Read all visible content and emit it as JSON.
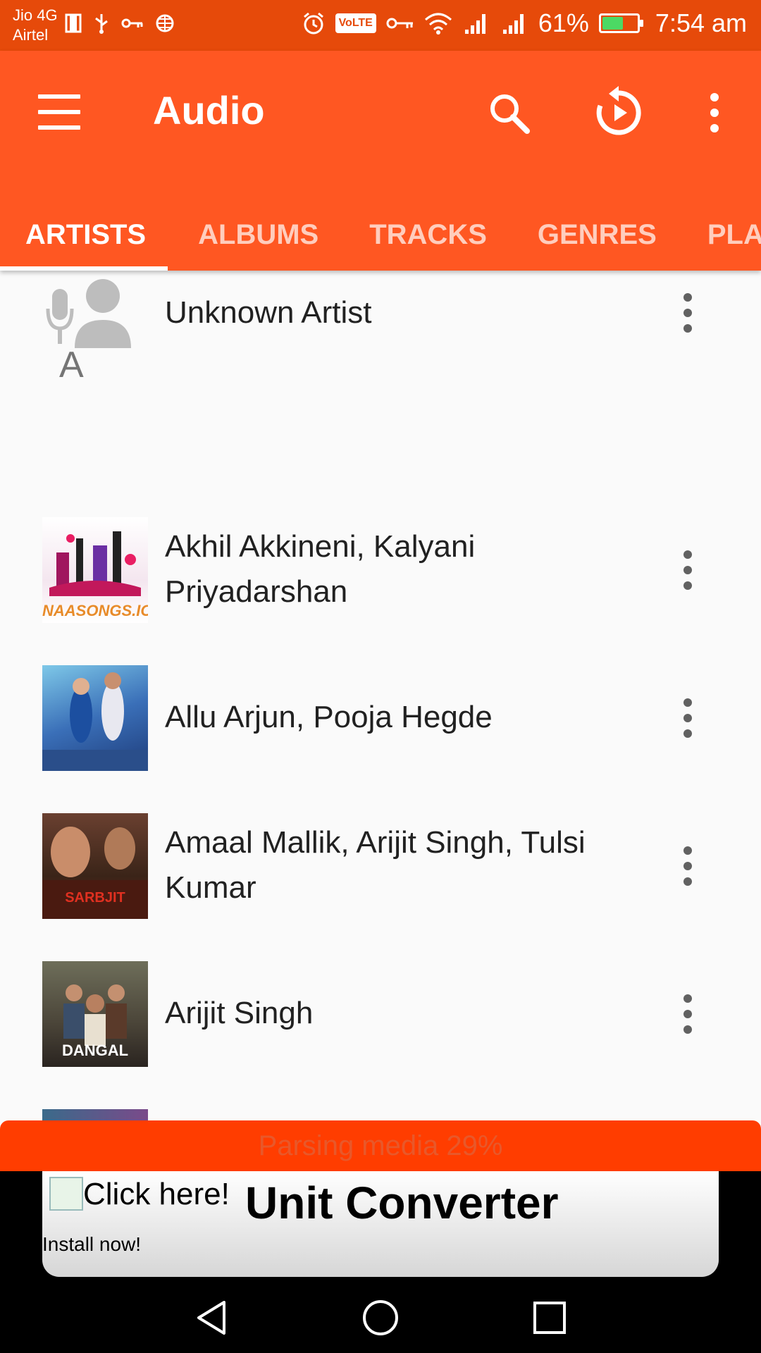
{
  "status_bar": {
    "carrier_1": "Jio 4G",
    "carrier_2": "Airtel",
    "volte": "VoLTE",
    "battery_percent": "61%",
    "battery_level": 0.61,
    "time": "7:54 am"
  },
  "app_bar": {
    "title": "Audio",
    "icons": [
      "menu-icon",
      "search-icon",
      "replay-icon",
      "more-vert-icon"
    ]
  },
  "tabs": [
    {
      "label": "ARTISTS",
      "active": true
    },
    {
      "label": "ALBUMS",
      "active": false
    },
    {
      "label": "TRACKS",
      "active": false
    },
    {
      "label": "GENRES",
      "active": false
    },
    {
      "label": "PLAYLISTS",
      "active": false
    }
  ],
  "list": {
    "unknown_artist": "Unknown Artist",
    "section_letter": "A",
    "artists": [
      {
        "name_line1": "Akhil Akkineni, Kalyani",
        "name_line2": "Priyadarshan",
        "thumb_text": "NAASONGS.IO"
      },
      {
        "name_line1": "Allu Arjun, Pooja Hegde",
        "name_line2": "",
        "thumb_text": ""
      },
      {
        "name_line1": "Amaal Mallik, Arijit Singh, Tulsi",
        "name_line2": "Kumar",
        "thumb_text": "SARBJIT"
      },
      {
        "name_line1": "Arijit Singh",
        "name_line2": "",
        "thumb_text": "DANGAL"
      }
    ]
  },
  "progress": {
    "label": "Parsing media 29%",
    "percent": 29
  },
  "ad": {
    "click_text": "Click here!",
    "title": "Unit Converter",
    "install_text": "Install now!"
  },
  "colors": {
    "status_bar": "#e64a0a",
    "app_bar": "#ff5722",
    "progress_bar": "#ff3d00"
  }
}
